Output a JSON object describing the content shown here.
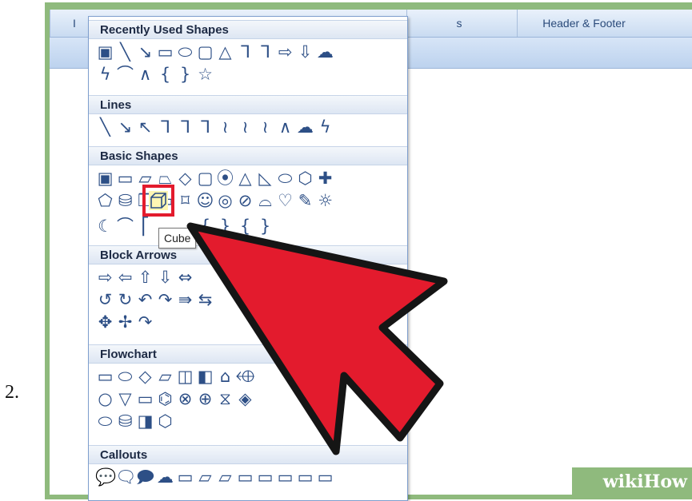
{
  "step": {
    "number": "2."
  },
  "ribbon": {
    "groups": [
      "I",
      "s",
      "Header & Footer"
    ]
  },
  "gallery": {
    "sections": [
      {
        "title": "Recently Used Shapes",
        "rows": [
          [
            "▣",
            "╲",
            "↘",
            "▭",
            "⬭",
            "▢",
            "△",
            "ᒣ",
            "ᒣ",
            "⇨",
            "⇩",
            "☁"
          ],
          [
            "ϟ",
            "⌒",
            "∧",
            "{",
            "}",
            "☆"
          ]
        ]
      },
      {
        "title": "Lines",
        "rows": [
          [
            "╲",
            "↘",
            "↖",
            "ᒣ",
            "ᒣ",
            "ᒣ",
            "≀",
            "≀",
            "≀",
            "∧",
            "☁",
            "ϟ"
          ]
        ]
      },
      {
        "title": "Basic Shapes",
        "rows": [
          [
            "▣",
            "▭",
            "▱",
            "⏢",
            "◇",
            "▢",
            "⦿",
            "△",
            "◺",
            "⬭",
            "⬡",
            "✚"
          ],
          [
            "⬠",
            "⛁",
            "❒",
            "▭",
            "⌑",
            "☺",
            "◎",
            "⊘",
            "⌓",
            "♡",
            "✎",
            "☼"
          ],
          [
            "☾",
            "⌒",
            "⎡",
            "",
            "",
            "{",
            "}",
            "{",
            "}"
          ]
        ]
      },
      {
        "title": "Block Arrows",
        "rows": [
          [
            "⇨",
            "⇦",
            "⇧",
            "⇩",
            "⇔"
          ],
          [
            "↺",
            "↻",
            "↶",
            "↷",
            "⇛",
            "⇆"
          ],
          [
            "✥",
            "✢",
            "↷"
          ]
        ]
      },
      {
        "title": "Flowchart",
        "rows": [
          [
            "▭",
            "⬭",
            "◇",
            "▱",
            "◫",
            "◧",
            "⌂",
            "⬲",
            "",
            "",
            "⬭",
            "⬯"
          ],
          [
            "○",
            "▽",
            "▭",
            "⌬",
            "⊗",
            "⊕",
            "⧖",
            "◈",
            "",
            "",
            "▽",
            "◖"
          ],
          [
            "⬭",
            "⛁",
            "◨",
            "⬡"
          ]
        ]
      },
      {
        "title": "Callouts",
        "rows": [
          [
            "💬",
            "🗨",
            "🗩",
            "☁",
            "▭",
            "▱",
            "▱",
            "▭",
            "▭",
            "▭",
            "▭",
            "▭"
          ]
        ]
      }
    ]
  },
  "tooltip": "Cube",
  "watermark": {
    "text": "wikiHow"
  },
  "colors": {
    "annotation_arrow": "#e31b2d",
    "frame": "#8fba7d",
    "icon": "#2d4f86"
  }
}
